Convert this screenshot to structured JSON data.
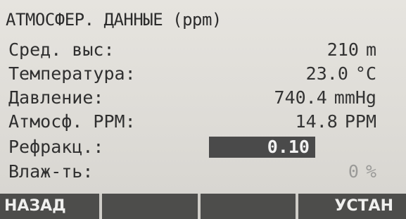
{
  "title": "АТМОСФЕР. ДАННЫЕ (ppm)",
  "rows": [
    {
      "label": "Сред. выс:",
      "value": "210",
      "unit": "m"
    },
    {
      "label": "Температура:",
      "value": "23.0",
      "unit": "°C"
    },
    {
      "label": "Давление:",
      "value": "740.4",
      "unit": "mmHg"
    },
    {
      "label": "Атмосф. PPM:",
      "value": "14.8",
      "unit": "PPM"
    },
    {
      "label": "Рефракц.:",
      "value": "0.10"
    },
    {
      "label": "Влаж-ть:",
      "value": "0",
      "unit": "%"
    }
  ],
  "softkeys": {
    "f1": "НАЗАД",
    "f2": "",
    "f3": "",
    "f4": "УСТАН"
  }
}
